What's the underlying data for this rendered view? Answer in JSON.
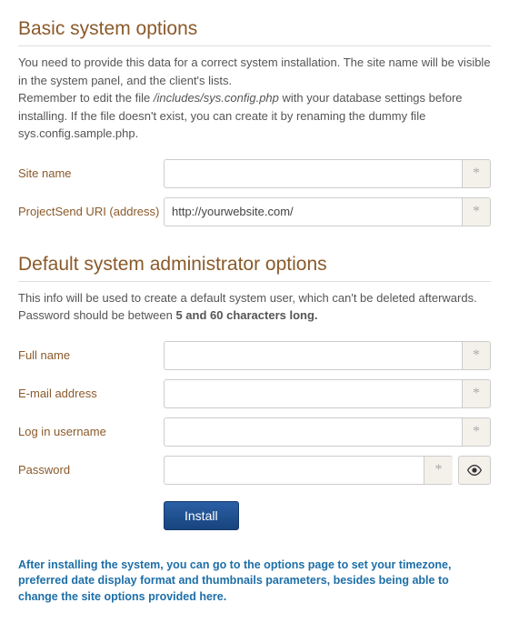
{
  "basic": {
    "heading": "Basic system options",
    "intro_p1a": "You need to provide this data for a correct system installation. The site name will be visible in the system panel, and the client's lists.",
    "intro_p2a": "Remember to edit the file ",
    "intro_p2_file": "/includes/sys.config.php",
    "intro_p2b": " with your database settings before installing. If the file doesn't exist, you can create it by renaming the dummy file sys.config.sample.php.",
    "site_name_label": "Site name",
    "site_name_value": "",
    "uri_label": "ProjectSend URI (address)",
    "uri_value": "http://yourwebsite.com/"
  },
  "admin": {
    "heading": "Default system administrator options",
    "intro_a": "This info will be used to create a default system user, which can't be deleted afterwards. Password should be between ",
    "intro_bold": "5 and 60 characters long.",
    "fullname_label": "Full name",
    "fullname_value": "",
    "email_label": "E-mail address",
    "email_value": "",
    "username_label": "Log in username",
    "username_value": "",
    "password_label": "Password",
    "password_value": ""
  },
  "install_label": "Install",
  "footer_note": "After installing the system, you can go to the options page to set your timezone, preferred date display format and thumbnails parameters, besides being able to change the site options provided here.",
  "asterisk": "*"
}
